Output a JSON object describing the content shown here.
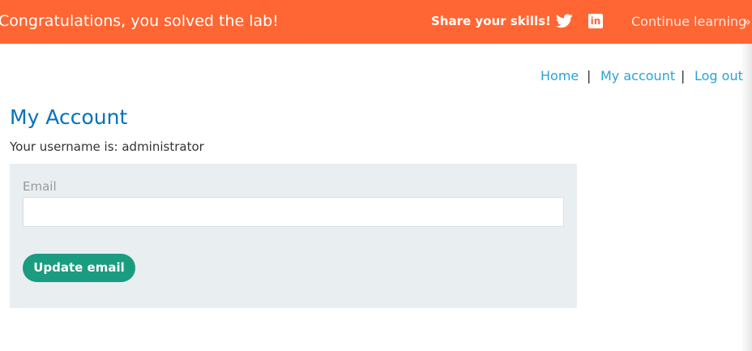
{
  "banner": {
    "message": "Congratulations, you solved the lab!",
    "share_label": "Share your skills!",
    "twitter_icon": "twitter-bird-icon",
    "linkedin_icon": "linkedin-icon",
    "linkedin_glyph": "in",
    "continue_label": "Continue learning",
    "continue_chevron": "»",
    "background_color": "#ff6633"
  },
  "nav": {
    "home": "Home",
    "my_account": "My account",
    "log_out": "Log out",
    "separator": "|",
    "link_color": "#29a3d4"
  },
  "main": {
    "title": "My Account",
    "username_line": "Your username is: administrator",
    "email_label": "Email",
    "email_value": "",
    "update_button": "Update email",
    "title_color": "#0071bc",
    "button_color": "#1a9c80",
    "panel_color": "#e9eef0"
  }
}
